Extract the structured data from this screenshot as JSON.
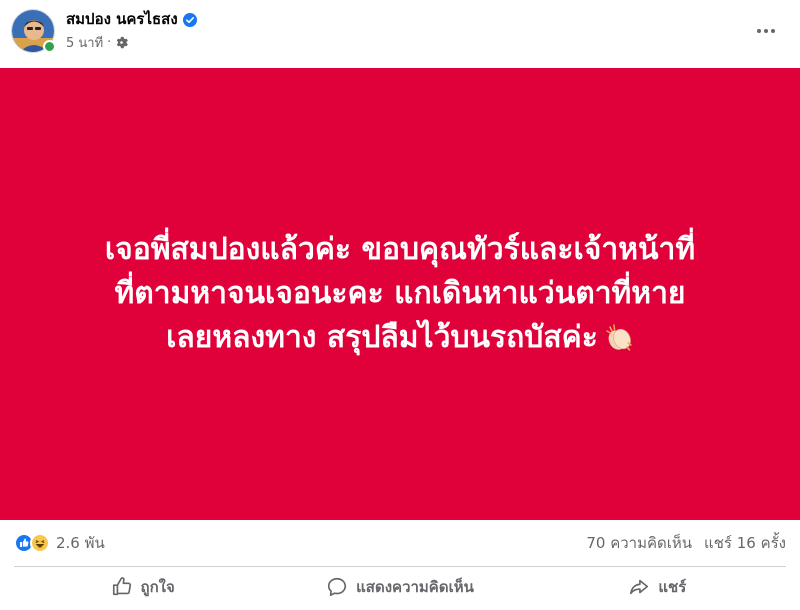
{
  "post": {
    "author_name": "สมปอง นครไธสง",
    "timestamp": "5 นาที",
    "separator": "·",
    "verified_icon": "verified-badge-icon",
    "privacy_icon": "gear-icon",
    "more_icon": "more-dots-icon",
    "background_color": "#e0003a",
    "text_lines": [
      "เจอพี่สมปองแล้วค่ะ ขอบคุณทัวร์และเจ้าหน้าที่",
      "ที่ตามหาจนเจอนะคะ แกเดินหาแว่นตาที่หาย",
      "เลยหลงทาง สรุปลืมไว้บนรถบัสค่ะ"
    ],
    "emoji_icon": "clapping-hands-icon"
  },
  "stats": {
    "reaction_icons": [
      "like-icon",
      "haha-icon"
    ],
    "reaction_count": "2.6 พัน",
    "comments": "70 ความคิดเห็น",
    "shares": "แชร์ 16 ครั้ง"
  },
  "actions": {
    "like_label": "ถูกใจ",
    "comment_label": "แสดงความคิดเห็น",
    "share_label": "แชร์"
  },
  "colors": {
    "accent_blue": "#1877f2",
    "online_green": "#31a24c",
    "secondary_text": "#65676b"
  }
}
